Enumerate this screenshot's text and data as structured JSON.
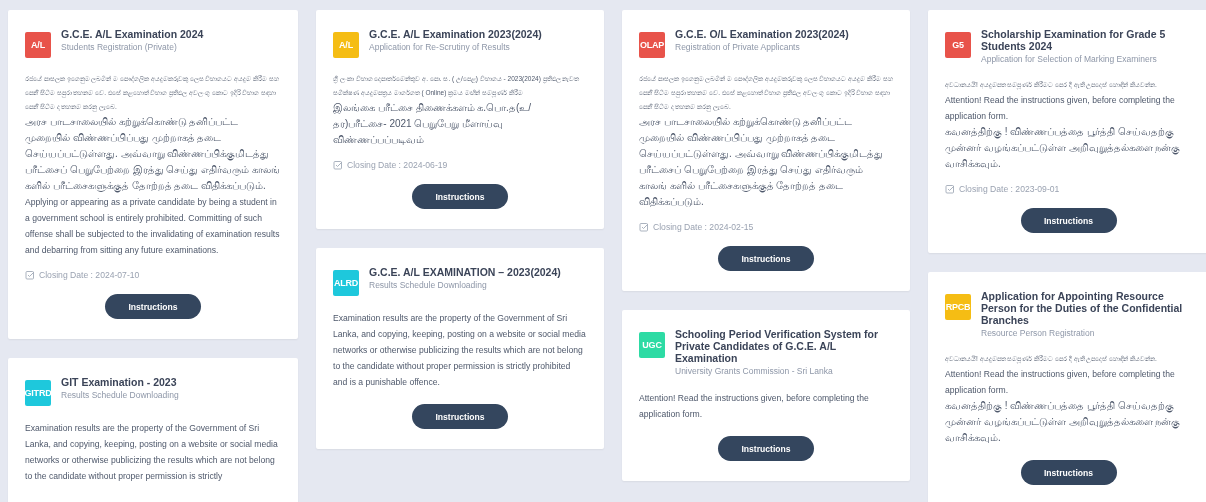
{
  "columns": [
    {
      "cards": [
        {
          "badge": "A/L",
          "color": "#e8534a",
          "title": "G.C.E. A/L Examination 2024",
          "subtitle": "Students Registration (Private)",
          "paragraphs": [
            {
              "kind": "sinhala",
              "text": "රජයේ පාසලක ඉගෙනුම ලබමින් ම පෞද්ගලික අයදුම්කරුවකු ලෙස විභාගයට අයදුම් කිරීම සහ පෙනී සිටීම සපුරා තහනම් වේ. එසේ කළහොත් විභාග ප්‍රතිඵල අවලංගු කොට ඉදිරි විභාග සඳහා පෙනී සිටීම ද තහනම් කරනු ලැබේ."
            },
            {
              "kind": "tamil",
              "text": "அரச பாடசாலையில் கற்றுக்கொண்டு தனிப்பட்ட முறையில் விண்ணப்பிப்பது முற்றாகத் தடை செய்யப்பட்டுள்ளது. அவ்வாறு விண்ணப்பிக்குமிடத்து பரீட்சைப் பெறுபேற்றை இரத்து செய்து எதிர்வரும் காலங் களில் பரீட்சைகளுக்குத் தோற்றத் தடை விதிக்கப்படும்."
            },
            {
              "kind": "english",
              "text": "Applying or appearing as a private candidate by being a student in a government school is entirely prohibited. Committing of such offense shall be subjected to the invalidating of examination results and debarring from sitting any future examinations."
            }
          ],
          "closing_date": "Closing Date : 2024-07-10",
          "button": "Instructions"
        },
        {
          "badge": "GITRD",
          "color": "#1ec8dc",
          "title": "GIT Examination - 2023",
          "subtitle": "Results Schedule Downloading",
          "paragraphs": [
            {
              "kind": "english",
              "text": "Examination results are the property of the Government of Sri Lanka, and copying, keeping, posting on a website or social media networks or otherwise publicizing the results which are not belong to the candidate without proper permission is strictly"
            }
          ]
        }
      ]
    },
    {
      "cards": [
        {
          "badge": "A/L",
          "color": "#f5bd14",
          "title": "G.C.E. A/L Examination 2023(2024)",
          "subtitle": "Application for Re-Scrutiny of Results",
          "paragraphs": [
            {
              "kind": "sinhala",
              "text": "ශ්‍රී ලංකා විභාග දෙපාර්තමේන්තුව අ. පො. ස. ( උ/පෙළ) විභාගය - 2023(2024) ප්‍රතිඵල නැවත සමීක්ෂණ අයදුම්පත්‍රය මාර්ගගත ( Online) ක්‍රමය මඟින් සම්පූර්ණ කිරීම"
            },
            {
              "kind": "tamil",
              "text": "இலங்கை பரீட்சை திணைக்களம் க.பொ.த(உ/ தர)பரீட்சை- 2021 பெறுபேறு மீளாய்வு விண்ணப்பப்படிவம்"
            }
          ],
          "closing_date": "Closing Date : 2024-06-19",
          "button": "Instructions"
        },
        {
          "badge": "ALRD",
          "color": "#1ec8dc",
          "title": "G.C.E. A/L EXAMINATION – 2023(2024)",
          "subtitle": "Results Schedule Downloading",
          "paragraphs": [
            {
              "kind": "english",
              "text": "Examination results are the property of the Government of Sri Lanka, and copying, keeping, posting on a website or social media networks or otherwise publicizing the results which are not belong to the candidate without proper permission is strictly prohibited and is a punishable offence."
            }
          ],
          "button": "Instructions"
        }
      ]
    },
    {
      "cards": [
        {
          "badge": "OLAP",
          "color": "#e8534a",
          "title": "G.C.E. O/L Examination 2023(2024)",
          "subtitle": "Registration of Private Applicants",
          "paragraphs": [
            {
              "kind": "sinhala",
              "text": "රජයේ පාසලක ඉගෙනුම ලබමින් ම පෞද්ගලික අයදුම්කරුවකු ලෙස විභාගයට අයදුම් කිරීම සහ පෙනී සිටීම සපුරා තහනම් වේ. එසේ කළහොත් විභාග ප්‍රතිඵල අවලංගු කොට ඉදිරි විභාග සඳහා පෙනී සිටීම ද තහනම් කරනු ලැබේ."
            },
            {
              "kind": "tamil",
              "text": "அரச பாடசாலையில் கற்றுக்கொண்டு தனிப்பட்ட முறையில் விண்ணப்பிப்பது முற்றாகத் தடை செய்யப்பட்டுள்ளது. அவ்வாறு விண்ணப்பிக்குமிடத்து பரீட்சைப் பெறுபேற்றை இரத்து செய்து எதிர்வரும் காலங் களில் பரீட்சைகளுக்குத் தோற்றத் தடை விதிக்கப்படும்."
            }
          ],
          "closing_date": "Closing Date : 2024-02-15",
          "button": "Instructions"
        },
        {
          "badge": "UGC",
          "color": "#2ddba4",
          "title": "Schooling Period Verification System for Private Candidates of G.C.E. A/L Examination",
          "subtitle": "University Grants Commission - Sri Lanka",
          "paragraphs": [
            {
              "kind": "english",
              "text": "Attention! Read the instructions given, before completing the application form."
            }
          ],
          "button": "Instructions"
        }
      ]
    },
    {
      "cards": [
        {
          "badge": "G5",
          "color": "#e8534a",
          "title": "Scholarship Examination for Grade 5 Students 2024",
          "subtitle": "Application for Selection of Marking Examiners",
          "paragraphs": [
            {
              "kind": "sinhala",
              "text": "අවධානයයි! අයදුම්පත සම්පූර්ණ කිරීමට පෙර දී ඇති උපදෙස් හොඳින් කියවන්න."
            },
            {
              "kind": "english",
              "text": "Attention! Read the instructions given, before completing the application form."
            },
            {
              "kind": "tamil",
              "text": "கவனத்திற்கு ! விண்ணப்பத்தை பூர்த்தி செய்வதற்கு முன்னர் வழங்கப்பட்டுள்ள அறிவுறுத்தல்களை நன்கு வாசிக்கவும்."
            }
          ],
          "closing_date": "Closing Date : 2023-09-01",
          "button": "Instructions"
        },
        {
          "badge": "RPCB",
          "color": "#f5bd14",
          "title": "Application for Appointing Resource Person for the Duties of the Confidential Branches",
          "subtitle": "Resource Person Registration",
          "paragraphs": [
            {
              "kind": "sinhala",
              "text": "අවධානයයි! අයදුම්පත සම්පූර්ණ කිරීමට පෙර දී ඇති උපදෙස් හොඳින් කියවන්න."
            },
            {
              "kind": "english",
              "text": "Attention! Read the instructions given, before completing the application form."
            },
            {
              "kind": "tamil",
              "text": "கவனத்திற்கு ! விண்ணப்பத்தை பூர்த்தி செய்வதற்கு முன்னர் வழங்கப்பட்டுள்ள அறிவுறுத்தல்களை நன்கு வாசிக்கவும்."
            }
          ],
          "button": "Instructions"
        }
      ]
    }
  ]
}
